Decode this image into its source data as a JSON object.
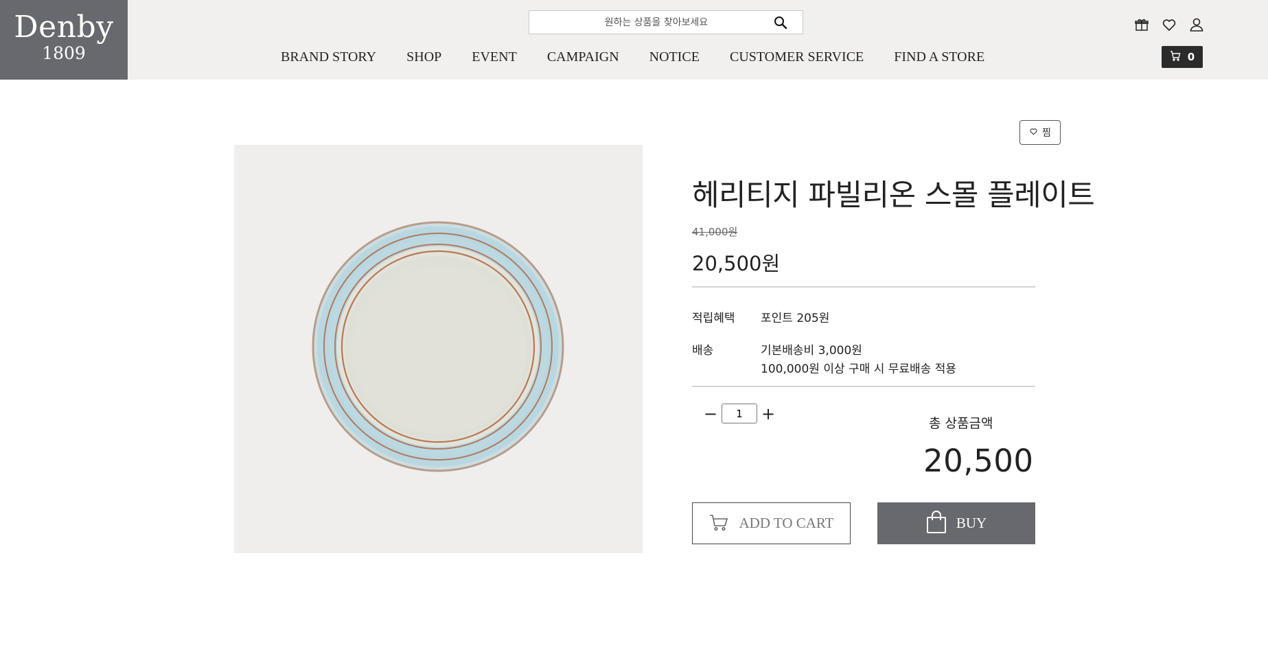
{
  "brand": {
    "name": "Denby",
    "year": "1809"
  },
  "search": {
    "placeholder": "원하는 상품을 찾아보세요",
    "icon": "search-icon"
  },
  "nav": {
    "items": [
      {
        "label": "BRAND STORY"
      },
      {
        "label": "SHOP"
      },
      {
        "label": "EVENT"
      },
      {
        "label": "CAMPAIGN"
      },
      {
        "label": "NOTICE"
      },
      {
        "label": "CUSTOMER SERVICE"
      },
      {
        "label": "FIND A STORE"
      }
    ]
  },
  "utility": {
    "icons": [
      "gift-icon",
      "heart-icon",
      "user-icon"
    ]
  },
  "cart": {
    "count": "0",
    "icon": "cart-icon"
  },
  "wishlist": {
    "label": "찜",
    "icon": "heart-icon"
  },
  "product": {
    "title": "헤리티지 파빌리온 스몰 플레이트",
    "original_price": "41,000원",
    "sale_price": "20,500원",
    "points_label": "적립혜택",
    "points_value": "포인트 205원",
    "shipping_label": "배송",
    "shipping_line1": "기본배송비 3,000원",
    "shipping_line2": "100,000원 이상 구매 시 무료배송 적용",
    "quantity": "1",
    "qty_minus": "−",
    "qty_plus": "+",
    "total_label": "총 상품금액",
    "total_value": "20,500"
  },
  "actions": {
    "add_to_cart": "ADD TO CART",
    "buy": "BUY"
  },
  "colors": {
    "header_bg": "#f1f0ef",
    "logo_bg": "#68696e",
    "buy_bg": "#68696e",
    "cart_pill": "#2b2b2b"
  }
}
